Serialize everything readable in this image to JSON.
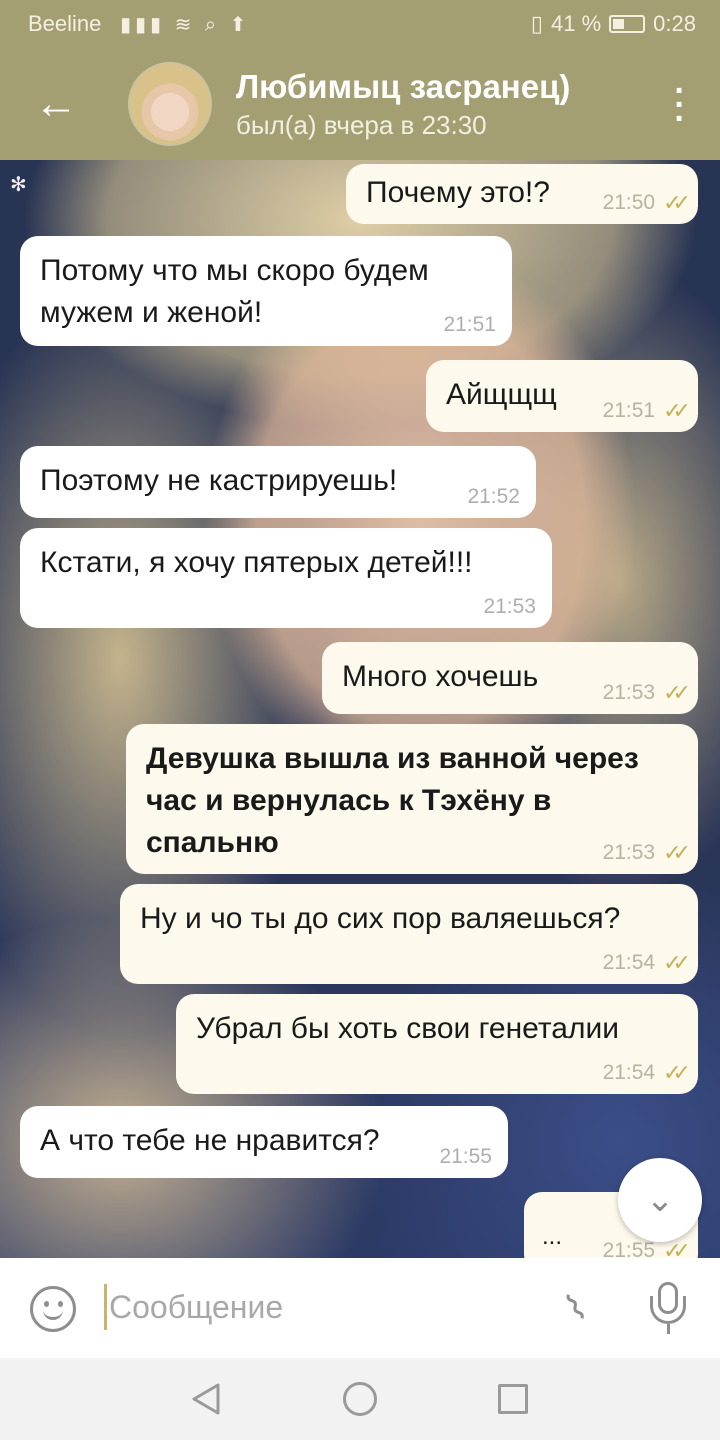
{
  "status_bar": {
    "carrier": "Beeline",
    "battery": "41 %",
    "battery_level": 0.41,
    "time": "0:28"
  },
  "header": {
    "title": "Любимыц засранец)",
    "subtitle": "был(а) вчера в 23:30"
  },
  "messages": [
    {
      "dir": "out",
      "text": "Почему это!?",
      "time": "21:50",
      "read": true
    },
    {
      "dir": "in",
      "text": "Потому что мы скоро будем мужем и женой!",
      "time": "21:51"
    },
    {
      "dir": "out",
      "text": "Айщщщ",
      "time": "21:51",
      "read": true
    },
    {
      "dir": "in",
      "text": "Поэтому не кастрируешь!",
      "time": "21:52"
    },
    {
      "dir": "in",
      "text": "Кстати, я хочу пятерых детей!!!",
      "time": "21:53"
    },
    {
      "dir": "out",
      "text": "Много хочешь",
      "time": "21:53",
      "read": true
    },
    {
      "dir": "out",
      "text": "Девушка вышла из ванной через час и вернулась к Тэхёну в спальню",
      "time": "21:53",
      "read": true,
      "bold": true
    },
    {
      "dir": "out",
      "text": "Ну и чо ты до сих пор валяешься?",
      "time": "21:54",
      "read": true
    },
    {
      "dir": "out",
      "text": "Убрал бы хоть свои генеталии",
      "time": "21:54",
      "read": true
    },
    {
      "dir": "in",
      "text": "А что тебе не нравится?",
      "time": "21:55"
    },
    {
      "dir": "out",
      "text": "...",
      "time": "21:55",
      "read": true
    }
  ],
  "input": {
    "placeholder": "Сообщение"
  },
  "icons": {
    "back": "arrow-left-icon",
    "menu": "more-vertical-icon",
    "emoji": "smiley-icon",
    "attach": "paperclip-icon",
    "mic": "microphone-icon",
    "scroll": "chevron-down-icon"
  },
  "colors": {
    "header": "#a39f73",
    "read_checks": "#c6b158",
    "incoming_bubble": "#ffffff",
    "outgoing_bubble": "#fdf9ec"
  }
}
